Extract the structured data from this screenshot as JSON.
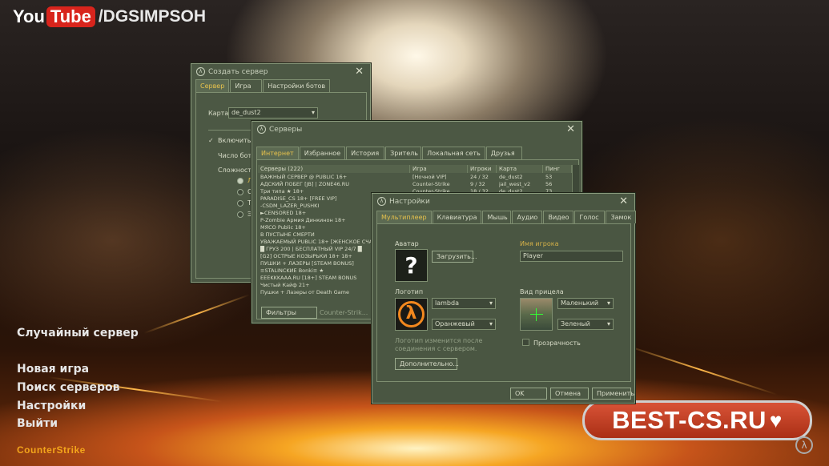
{
  "watermark": {
    "you": "You",
    "tube": "Tube",
    "channel": "/DGSIMPSOH"
  },
  "main_menu": {
    "random_server": "Случайный сервер",
    "new_game": "Новая игра",
    "find_servers": "Поиск серверов",
    "settings": "Настройки",
    "quit": "Выйти"
  },
  "game_logo": "CounterStrike",
  "brand_badge": "BEST-CS.RU",
  "create_server": {
    "title": "Создать сервер",
    "tabs": [
      "Сервер",
      "Игра",
      "Настройки ботов"
    ],
    "map_label": "Карта",
    "map_value": "de_dust2",
    "enable_bots": "Включить б",
    "bot_count": "Число боты",
    "difficulty": "Сложность",
    "difficulty_opts": [
      "Л",
      "С",
      "Т",
      "Э"
    ]
  },
  "servers": {
    "title": "Серверы",
    "tabs": [
      "Интернет",
      "Избранное",
      "История",
      "Зритель",
      "Локальная сеть",
      "Друзья"
    ],
    "columns": [
      "Серверы (222)",
      "Игра",
      "Игроки",
      "Карта",
      "Пинг"
    ],
    "rows": [
      {
        "name": "ВАЖНЫЙ СЕРВЕР @ PUBLIC 16+",
        "game": "[Ночной VIP]",
        "players": "24 / 32",
        "map": "de_dust2",
        "ping": "53"
      },
      {
        "name": "АДСКИЙ ПОБЕГ [JB] | ZONE46.RU",
        "game": "Counter-Strike",
        "players": "9 / 32",
        "map": "jail_west_v2",
        "ping": "56"
      },
      {
        "name": "Три типа ★ 18+",
        "game": "Counter-Strike",
        "players": "18 / 32",
        "map": "de_dust2",
        "ping": "73"
      },
      {
        "name": "PARADISE_CS 18+ [FREE VIP]",
        "game": "",
        "players": "",
        "map": "",
        "ping": ""
      },
      {
        "name": "-CSDM_LAZER_PUSHKI",
        "game": "",
        "players": "",
        "map": "",
        "ping": ""
      },
      {
        "name": "►CENSORED 18+",
        "game": "",
        "players": "",
        "map": "",
        "ping": ""
      },
      {
        "name": "P-Zombie Армия Динкинон 18+",
        "game": "",
        "players": "",
        "map": "",
        "ping": ""
      },
      {
        "name": "MЯСО Public 18+",
        "game": "",
        "players": "",
        "map": "",
        "ping": ""
      },
      {
        "name": "В ПУСТЫНЕ СМЕРТИ",
        "game": "",
        "players": "",
        "map": "",
        "ping": ""
      },
      {
        "name": "УВАЖАЕМЫЙ PUBLIC 18+ [ЖЕНСКОЕ СЧАСТ",
        "game": "",
        "players": "",
        "map": "",
        "ping": ""
      },
      {
        "name": "█ ГРУЗ 200 | БЕСПЛАТНЫЙ VIP 24/7 █",
        "game": "",
        "players": "",
        "map": "",
        "ping": ""
      },
      {
        "name": "[G2] ОСТРЫЕ КОЗЫРЬКИ 18+ 18+",
        "game": "",
        "players": "",
        "map": "",
        "ping": ""
      },
      {
        "name": "ПУШКИ + ЛАЗЕРЫ [STEAM BONUS]",
        "game": "",
        "players": "",
        "map": "",
        "ping": ""
      },
      {
        "name": "≡STALINCKИE Bonki≡ ★",
        "game": "",
        "players": "",
        "map": "",
        "ping": ""
      },
      {
        "name": "EEEKKKAAA.RU [18+] STEAM BONUS",
        "game": "",
        "players": "",
        "map": "",
        "ping": ""
      },
      {
        "name": "Чистый Кайф 21+",
        "game": "",
        "players": "",
        "map": "",
        "ping": ""
      },
      {
        "name": "Пушки + Лазеры от Death Game",
        "game": "",
        "players": "",
        "map": "",
        "ping": ""
      }
    ],
    "filter_button": "Фильтры",
    "filter_game": "Counter-Strik..."
  },
  "settings_dialog": {
    "title": "Настройки",
    "tabs": [
      "Мультиплеер",
      "Клавиатура",
      "Мышь",
      "Аудио",
      "Видео",
      "Голос",
      "Замок"
    ],
    "avatar_label": "Аватар",
    "avatar_glyph": "?",
    "upload_button": "Загрузить...",
    "player_name_label": "Имя игрока",
    "player_name_value": "Player",
    "logo_label": "Логотип",
    "logo_value": "lambda",
    "logo_color": "Оранжевый",
    "crosshair_label": "Вид прицела",
    "crosshair_size": "Маленький",
    "crosshair_color": "Зеленый",
    "transparent_label": "Прозрачность",
    "logo_note": "Логотип изменится после соединения с сервером.",
    "advanced_button": "Дополнительно...",
    "ok": "OK",
    "cancel": "Отмена",
    "apply": "Применить"
  }
}
